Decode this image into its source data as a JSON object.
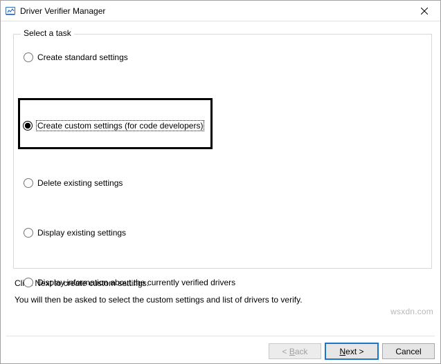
{
  "window": {
    "title": "Driver Verifier Manager"
  },
  "group": {
    "legend": "Select a task"
  },
  "options": {
    "create_standard": {
      "label": "Create standard settings"
    },
    "create_custom": {
      "label": "Create custom settings (for code developers)"
    },
    "delete_existing": {
      "label": "Delete existing settings"
    },
    "display_existing": {
      "label": "Display existing settings"
    },
    "display_info": {
      "label": "Display information about the currently verified drivers"
    }
  },
  "hints": {
    "line1": "Click Next to create custom settings.",
    "line2": "You will then be asked to select the custom settings and list of drivers to verify."
  },
  "buttons": {
    "back": {
      "label_prefix": "< ",
      "mnemonic": "B",
      "label_suffix": "ack"
    },
    "next": {
      "mnemonic": "N",
      "label_suffix": "ext >"
    },
    "cancel": {
      "label": "Cancel"
    }
  },
  "watermark": "wsxdn.com"
}
